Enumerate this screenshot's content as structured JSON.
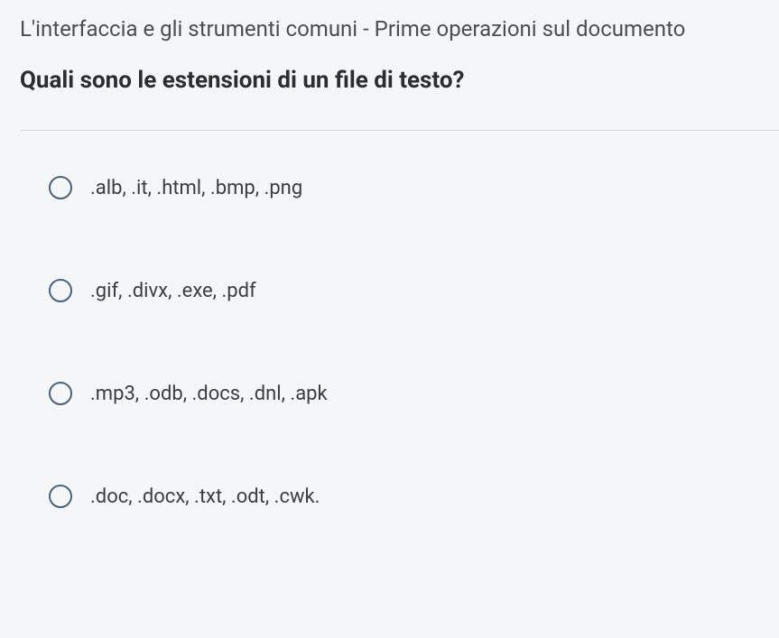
{
  "breadcrumb": "L'interfaccia e gli strumenti comuni - Prime operazioni sul documento",
  "question": "Quali sono le estensioni di un file di testo?",
  "options": [
    {
      "label": ".alb, .it, .html, .bmp, .png"
    },
    {
      "label": ".gif, .divx, .exe, .pdf"
    },
    {
      "label": ".mp3, .odb, .docs, .dnl, .apk"
    },
    {
      "label": ".doc, .docx, .txt, .odt, .cwk."
    }
  ]
}
